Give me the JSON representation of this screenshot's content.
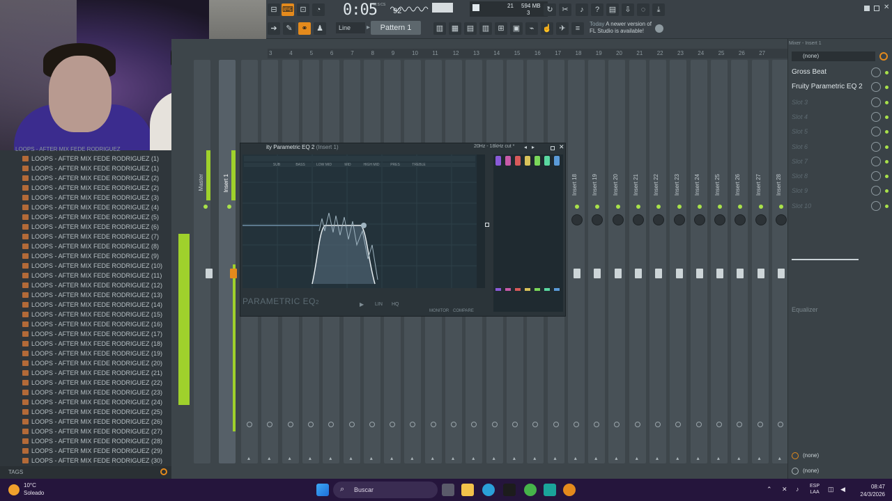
{
  "toolbar": {
    "time": "0:05",
    "time_sub": "92",
    "time_unit": "M:S:CS",
    "memory_value": "594 MB",
    "memory_cpu": "3",
    "memory_poly": "21",
    "line_mode": "Line",
    "pattern": "Pattern 1",
    "news_today": "Today",
    "news_text": "A newer version of FL Studio is available!"
  },
  "browser": {
    "title": "LOOPS - AFTER MIX FEDE RODRIGUEZ",
    "items": [
      "LOOPS - AFTER MIX FEDE RODRIGUEZ (1)",
      "LOOPS - AFTER MIX FEDE RODRIGUEZ (1)",
      "LOOPS - AFTER MIX FEDE RODRIGUEZ (2)",
      "LOOPS - AFTER MIX FEDE RODRIGUEZ (2)",
      "LOOPS - AFTER MIX FEDE RODRIGUEZ (3)",
      "LOOPS - AFTER MIX FEDE RODRIGUEZ (4)",
      "LOOPS - AFTER MIX FEDE RODRIGUEZ (5)",
      "LOOPS - AFTER MIX FEDE RODRIGUEZ (6)",
      "LOOPS - AFTER MIX FEDE RODRIGUEZ (7)",
      "LOOPS - AFTER MIX FEDE RODRIGUEZ (8)",
      "LOOPS - AFTER MIX FEDE RODRIGUEZ (9)",
      "LOOPS - AFTER MIX FEDE RODRIGUEZ (10)",
      "LOOPS - AFTER MIX FEDE RODRIGUEZ (11)",
      "LOOPS - AFTER MIX FEDE RODRIGUEZ (12)",
      "LOOPS - AFTER MIX FEDE RODRIGUEZ (13)",
      "LOOPS - AFTER MIX FEDE RODRIGUEZ (14)",
      "LOOPS - AFTER MIX FEDE RODRIGUEZ (15)",
      "LOOPS - AFTER MIX FEDE RODRIGUEZ (16)",
      "LOOPS - AFTER MIX FEDE RODRIGUEZ (17)",
      "LOOPS - AFTER MIX FEDE RODRIGUEZ (18)",
      "LOOPS - AFTER MIX FEDE RODRIGUEZ (19)",
      "LOOPS - AFTER MIX FEDE RODRIGUEZ (20)",
      "LOOPS - AFTER MIX FEDE RODRIGUEZ (21)",
      "LOOPS - AFTER MIX FEDE RODRIGUEZ (22)",
      "LOOPS - AFTER MIX FEDE RODRIGUEZ (23)",
      "LOOPS - AFTER MIX FEDE RODRIGUEZ (24)",
      "LOOPS - AFTER MIX FEDE RODRIGUEZ (25)",
      "LOOPS - AFTER MIX FEDE RODRIGUEZ (26)",
      "LOOPS - AFTER MIX FEDE RODRIGUEZ (27)",
      "LOOPS - AFTER MIX FEDE RODRIGUEZ (28)",
      "LOOPS - AFTER MIX FEDE RODRIGUEZ (29)",
      "LOOPS - AFTER MIX FEDE RODRIGUEZ (30)"
    ],
    "tags_label": "TAGS"
  },
  "mixer": {
    "ruler": [
      "3",
      "4",
      "5",
      "6",
      "7",
      "8",
      "9",
      "10",
      "11",
      "12",
      "13",
      "14",
      "15",
      "16",
      "17",
      "18",
      "19",
      "20",
      "21",
      "22",
      "23",
      "24",
      "25",
      "26",
      "27"
    ],
    "master_label": "Master",
    "insert1_label": "Insert 1",
    "right_inserts": [
      "Insert 18",
      "Insert 19",
      "Insert 20",
      "Insert 21",
      "Insert 22",
      "Insert 23",
      "Insert 24",
      "Insert 25",
      "Insert 26",
      "Insert 27",
      "Insert 28"
    ]
  },
  "plugin": {
    "title": "ity Parametric EQ 2",
    "title_sub": "(Insert 1)",
    "range": "20Hz - 18kHz cut *",
    "logo": "PARAMETRIC EQ",
    "logo_num": "2",
    "band_labels": [
      "SUB",
      "BASS",
      "LOW MID",
      "MID",
      "HIGH MID",
      "PRES",
      "TREBLE"
    ],
    "lin_label": "LIN",
    "hq_label": "HQ",
    "monitor_label": "MONITOR",
    "compare_label": "COMPARE"
  },
  "rpanel": {
    "title": "Mixer - Insert 1",
    "selector": "(none)",
    "slots": [
      "Gross Beat",
      "Fruity Parametric EQ 2",
      "Slot 3",
      "Slot 4",
      "Slot 5",
      "Slot 6",
      "Slot 7",
      "Slot 8",
      "Slot 9",
      "Slot 10"
    ],
    "eq_label": "Equalizer",
    "out1": "(none)",
    "out2": "(none)"
  },
  "taskbar": {
    "temp": "10°C",
    "weather": "Soleado",
    "search": "Buscar",
    "lang1": "ESP",
    "lang2": "LAA",
    "time": "08:47",
    "date": "24/3/2026"
  },
  "colors": {
    "accent": "#e48a1c",
    "meter": "#9fd12c",
    "led": "#a9e24a"
  }
}
